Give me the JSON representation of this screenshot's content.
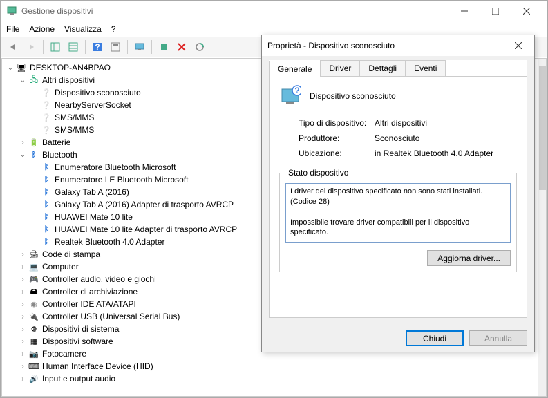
{
  "window_title": "Gestione dispositivi",
  "menubar": [
    "File",
    "Azione",
    "Visualizza",
    "?"
  ],
  "root_node": "DESKTOP-AN4BPAO",
  "tree": {
    "altri": {
      "label": "Altri dispositivi",
      "items": [
        "Dispositivo sconosciuto",
        "NearbyServerSocket",
        "SMS/MMS",
        "SMS/MMS"
      ]
    },
    "batterie": "Batterie",
    "bluetooth": {
      "label": "Bluetooth",
      "items": [
        "Enumeratore Bluetooth Microsoft",
        "Enumeratore LE Bluetooth Microsoft",
        "Galaxy Tab A (2016)",
        "Galaxy Tab A (2016) Adapter di trasporto AVRCP",
        "HUAWEI Mate 10 lite",
        "HUAWEI Mate 10 lite Adapter di trasporto AVRCP",
        "Realtek Bluetooth 4.0 Adapter"
      ]
    },
    "misc": [
      "Code di stampa",
      "Computer",
      "Controller audio, video e giochi",
      "Controller di archiviazione",
      "Controller IDE ATA/ATAPI",
      "Controller USB (Universal Serial Bus)",
      "Dispositivi di sistema",
      "Dispositivi software",
      "Fotocamere",
      "Human Interface Device (HID)",
      "Input e output audio"
    ]
  },
  "dialog": {
    "title": "Proprietà - Dispositivo sconosciuto",
    "tabs": [
      "Generale",
      "Driver",
      "Dettagli",
      "Eventi"
    ],
    "device_name": "Dispositivo sconosciuto",
    "type_label": "Tipo di dispositivo:",
    "type_value": "Altri dispositivi",
    "vendor_label": "Produttore:",
    "vendor_value": "Sconosciuto",
    "location_label": "Ubicazione:",
    "location_value": "in Realtek Bluetooth 4.0 Adapter",
    "status_legend": "Stato dispositivo",
    "status_text": "I driver del dispositivo specificato non sono stati installati. (Codice 28)\n\nImpossibile trovare driver compatibili per il dispositivo specificato.\n\nPer trovare un driver per questo dispositivo, fare clic su Aggiorna driver.",
    "update_btn": "Aggiorna driver...",
    "close_btn": "Chiudi",
    "cancel_btn": "Annulla"
  }
}
